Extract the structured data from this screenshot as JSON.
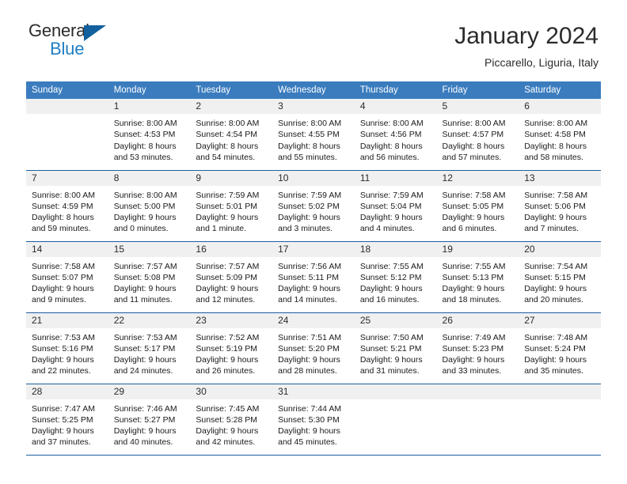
{
  "brand": {
    "word_one": "General",
    "word_two": "Blue",
    "flag_icon": "triangle-flag-icon"
  },
  "header": {
    "month_title": "January 2024",
    "location": "Piccarello, Liguria, Italy"
  },
  "calendar": {
    "weekday_headers": [
      "Sunday",
      "Monday",
      "Tuesday",
      "Wednesday",
      "Thursday",
      "Friday",
      "Saturday"
    ],
    "header_bg": "#3a7cbe",
    "rule_color": "#1f5fa0",
    "daynum_bg": "#f0f0f0",
    "weeks": [
      [
        {
          "day": "",
          "lines": []
        },
        {
          "day": "1",
          "lines": [
            "Sunrise: 8:00 AM",
            "Sunset: 4:53 PM",
            "Daylight: 8 hours",
            "and 53 minutes."
          ]
        },
        {
          "day": "2",
          "lines": [
            "Sunrise: 8:00 AM",
            "Sunset: 4:54 PM",
            "Daylight: 8 hours",
            "and 54 minutes."
          ]
        },
        {
          "day": "3",
          "lines": [
            "Sunrise: 8:00 AM",
            "Sunset: 4:55 PM",
            "Daylight: 8 hours",
            "and 55 minutes."
          ]
        },
        {
          "day": "4",
          "lines": [
            "Sunrise: 8:00 AM",
            "Sunset: 4:56 PM",
            "Daylight: 8 hours",
            "and 56 minutes."
          ]
        },
        {
          "day": "5",
          "lines": [
            "Sunrise: 8:00 AM",
            "Sunset: 4:57 PM",
            "Daylight: 8 hours",
            "and 57 minutes."
          ]
        },
        {
          "day": "6",
          "lines": [
            "Sunrise: 8:00 AM",
            "Sunset: 4:58 PM",
            "Daylight: 8 hours",
            "and 58 minutes."
          ]
        }
      ],
      [
        {
          "day": "7",
          "lines": [
            "Sunrise: 8:00 AM",
            "Sunset: 4:59 PM",
            "Daylight: 8 hours",
            "and 59 minutes."
          ]
        },
        {
          "day": "8",
          "lines": [
            "Sunrise: 8:00 AM",
            "Sunset: 5:00 PM",
            "Daylight: 9 hours",
            "and 0 minutes."
          ]
        },
        {
          "day": "9",
          "lines": [
            "Sunrise: 7:59 AM",
            "Sunset: 5:01 PM",
            "Daylight: 9 hours",
            "and 1 minute."
          ]
        },
        {
          "day": "10",
          "lines": [
            "Sunrise: 7:59 AM",
            "Sunset: 5:02 PM",
            "Daylight: 9 hours",
            "and 3 minutes."
          ]
        },
        {
          "day": "11",
          "lines": [
            "Sunrise: 7:59 AM",
            "Sunset: 5:04 PM",
            "Daylight: 9 hours",
            "and 4 minutes."
          ]
        },
        {
          "day": "12",
          "lines": [
            "Sunrise: 7:58 AM",
            "Sunset: 5:05 PM",
            "Daylight: 9 hours",
            "and 6 minutes."
          ]
        },
        {
          "day": "13",
          "lines": [
            "Sunrise: 7:58 AM",
            "Sunset: 5:06 PM",
            "Daylight: 9 hours",
            "and 7 minutes."
          ]
        }
      ],
      [
        {
          "day": "14",
          "lines": [
            "Sunrise: 7:58 AM",
            "Sunset: 5:07 PM",
            "Daylight: 9 hours",
            "and 9 minutes."
          ]
        },
        {
          "day": "15",
          "lines": [
            "Sunrise: 7:57 AM",
            "Sunset: 5:08 PM",
            "Daylight: 9 hours",
            "and 11 minutes."
          ]
        },
        {
          "day": "16",
          "lines": [
            "Sunrise: 7:57 AM",
            "Sunset: 5:09 PM",
            "Daylight: 9 hours",
            "and 12 minutes."
          ]
        },
        {
          "day": "17",
          "lines": [
            "Sunrise: 7:56 AM",
            "Sunset: 5:11 PM",
            "Daylight: 9 hours",
            "and 14 minutes."
          ]
        },
        {
          "day": "18",
          "lines": [
            "Sunrise: 7:55 AM",
            "Sunset: 5:12 PM",
            "Daylight: 9 hours",
            "and 16 minutes."
          ]
        },
        {
          "day": "19",
          "lines": [
            "Sunrise: 7:55 AM",
            "Sunset: 5:13 PM",
            "Daylight: 9 hours",
            "and 18 minutes."
          ]
        },
        {
          "day": "20",
          "lines": [
            "Sunrise: 7:54 AM",
            "Sunset: 5:15 PM",
            "Daylight: 9 hours",
            "and 20 minutes."
          ]
        }
      ],
      [
        {
          "day": "21",
          "lines": [
            "Sunrise: 7:53 AM",
            "Sunset: 5:16 PM",
            "Daylight: 9 hours",
            "and 22 minutes."
          ]
        },
        {
          "day": "22",
          "lines": [
            "Sunrise: 7:53 AM",
            "Sunset: 5:17 PM",
            "Daylight: 9 hours",
            "and 24 minutes."
          ]
        },
        {
          "day": "23",
          "lines": [
            "Sunrise: 7:52 AM",
            "Sunset: 5:19 PM",
            "Daylight: 9 hours",
            "and 26 minutes."
          ]
        },
        {
          "day": "24",
          "lines": [
            "Sunrise: 7:51 AM",
            "Sunset: 5:20 PM",
            "Daylight: 9 hours",
            "and 28 minutes."
          ]
        },
        {
          "day": "25",
          "lines": [
            "Sunrise: 7:50 AM",
            "Sunset: 5:21 PM",
            "Daylight: 9 hours",
            "and 31 minutes."
          ]
        },
        {
          "day": "26",
          "lines": [
            "Sunrise: 7:49 AM",
            "Sunset: 5:23 PM",
            "Daylight: 9 hours",
            "and 33 minutes."
          ]
        },
        {
          "day": "27",
          "lines": [
            "Sunrise: 7:48 AM",
            "Sunset: 5:24 PM",
            "Daylight: 9 hours",
            "and 35 minutes."
          ]
        }
      ],
      [
        {
          "day": "28",
          "lines": [
            "Sunrise: 7:47 AM",
            "Sunset: 5:25 PM",
            "Daylight: 9 hours",
            "and 37 minutes."
          ]
        },
        {
          "day": "29",
          "lines": [
            "Sunrise: 7:46 AM",
            "Sunset: 5:27 PM",
            "Daylight: 9 hours",
            "and 40 minutes."
          ]
        },
        {
          "day": "30",
          "lines": [
            "Sunrise: 7:45 AM",
            "Sunset: 5:28 PM",
            "Daylight: 9 hours",
            "and 42 minutes."
          ]
        },
        {
          "day": "31",
          "lines": [
            "Sunrise: 7:44 AM",
            "Sunset: 5:30 PM",
            "Daylight: 9 hours",
            "and 45 minutes."
          ]
        },
        {
          "day": "",
          "lines": []
        },
        {
          "day": "",
          "lines": []
        },
        {
          "day": "",
          "lines": []
        }
      ]
    ]
  }
}
